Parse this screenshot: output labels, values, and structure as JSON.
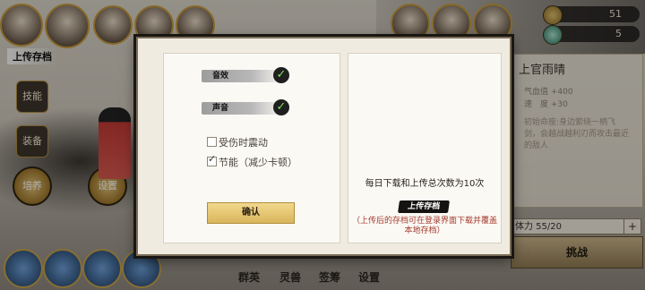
{
  "hud": {
    "resources": [
      {
        "icon": "coin-icon",
        "value": "51"
      },
      {
        "icon": "jade-icon",
        "value": "5"
      }
    ],
    "upload_label": "上传存档"
  },
  "background": {
    "side_buttons": [
      "技能",
      "装备"
    ],
    "gear_buttons": [
      "培养",
      "设置"
    ],
    "bottom_tabs": [
      "群英",
      "灵兽",
      "签筹",
      "设置"
    ]
  },
  "character_panel": {
    "name": "上官雨晴",
    "stats": [
      {
        "label": "气血值",
        "value": "+400"
      },
      {
        "label": "速　度",
        "value": "+30"
      }
    ],
    "description": "初始命座:身边萦绕一柄飞剑，会越战越利刃而攻击最近的敌人",
    "stamina": "体力 55/20",
    "stamina_plus": "+",
    "challenge_button": "挑战"
  },
  "dialog": {
    "toggles": [
      {
        "label": "音效",
        "checked": true
      },
      {
        "label": "声音",
        "checked": true
      }
    ],
    "checkboxes": [
      {
        "label": "受伤时震动",
        "checked": false
      },
      {
        "label": "节能（减少卡顿）",
        "checked": true
      }
    ],
    "confirm_button": "确认",
    "limit_text": "每日下载和上传总次数为10次",
    "upload_button": "上传存档",
    "upload_note": "（上传后的存档可在登录界面下载并覆盖本地存档）"
  }
}
